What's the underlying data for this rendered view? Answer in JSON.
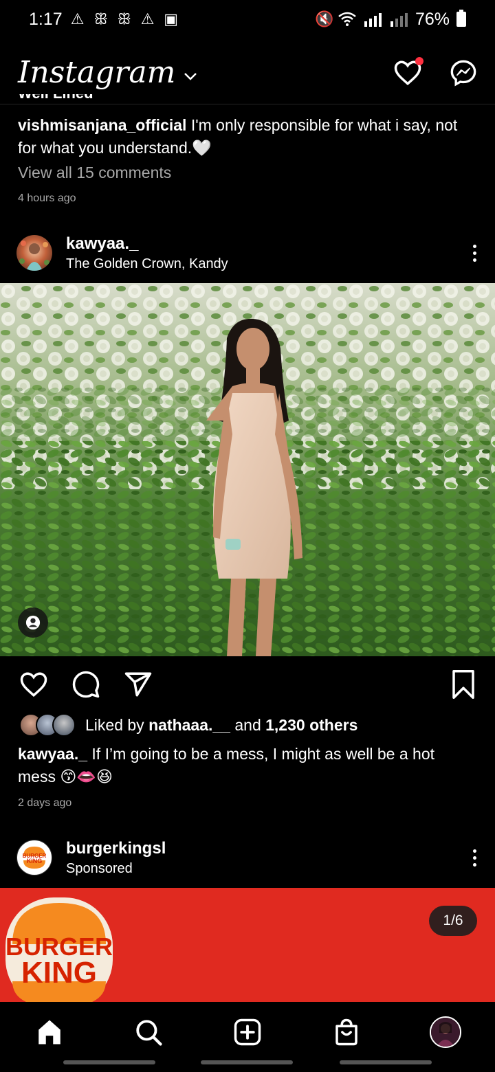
{
  "status_bar": {
    "time": "1:17",
    "battery": "76%"
  },
  "header": {
    "logo": "Instagram"
  },
  "prev_post": {
    "cut_text": "Well Lined",
    "username": "vishmisanjana_official",
    "caption": "I'm only responsible for what i say, not for what you understand.🤍",
    "view_comments": "View all 15 comments",
    "timestamp": "4 hours ago"
  },
  "post": {
    "username": "kawyaa._",
    "location": "The Golden Crown, Kandy",
    "liked_by_prefix": "Liked by",
    "liked_by_user": "nathaaa.__",
    "liked_by_and": "and",
    "liked_by_count": "1,230 others",
    "caption": "If I’m going to be a mess, I might as well be a hot mess 😙👄😆",
    "timestamp": "2 days ago"
  },
  "sponsored": {
    "username": "burgerkingsl",
    "label": "Sponsored",
    "logo_line1": "BURGER",
    "logo_line2": "KING",
    "small_logo_line1": "BURGER",
    "small_logo_line2": "KING",
    "counter": "1/6"
  },
  "colors": {
    "background": "#000000",
    "secondary_text": "#a8a8a8",
    "notification": "#ff3040",
    "ad_red": "#e02a20",
    "bk_orange": "#f58a1f",
    "bk_red": "#d62300"
  }
}
